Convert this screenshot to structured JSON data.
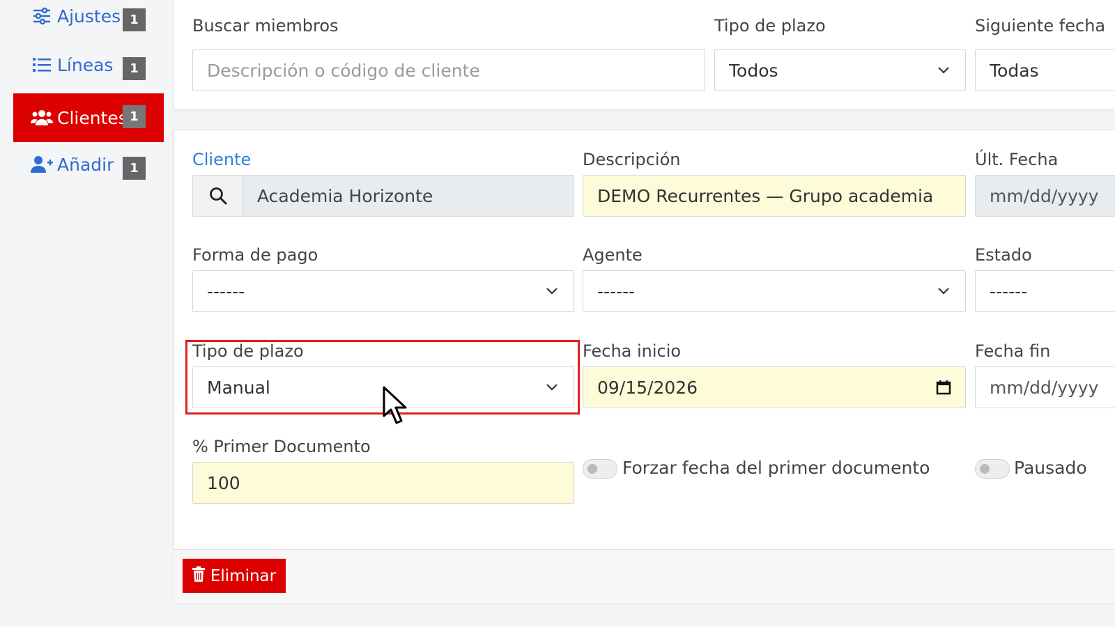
{
  "sidebar": {
    "items": [
      {
        "label": "Ajustes",
        "badge": "1",
        "icon": "sliders-icon"
      },
      {
        "label": "Líneas",
        "badge": "1",
        "icon": "list-icon"
      },
      {
        "label": "Clientes",
        "badge": "1",
        "icon": "users-icon",
        "active": true
      },
      {
        "label": "Añadir",
        "badge": "1",
        "icon": "user-plus-icon"
      }
    ]
  },
  "filters": {
    "search_label": "Buscar miembros",
    "search_placeholder": "Descripción o código de cliente",
    "term_type_label": "Tipo de plazo",
    "term_type_value": "Todos",
    "next_date_label": "Siguiente fecha",
    "next_date_value": "Todas"
  },
  "form": {
    "client_label": "Cliente",
    "client_value": "Academia Horizonte",
    "description_label": "Descripción",
    "description_value": "DEMO Recurrentes — Grupo academia",
    "last_date_label": "Últ. Fecha",
    "last_date_value": "mm/dd/yyyy",
    "payment_label": "Forma de pago",
    "payment_value": "------",
    "agent_label": "Agente",
    "agent_value": "------",
    "status_label": "Estado",
    "status_value": "------",
    "term_label": "Tipo de plazo",
    "term_value": "Manual",
    "start_date_label": "Fecha inicio",
    "start_date_value": "09/15/2026",
    "end_date_label": "Fecha fin",
    "end_date_value": "mm/dd/yyyy",
    "first_doc_label": "% Primer Documento",
    "first_doc_value": "100",
    "force_date_label": "Forzar fecha del primer documento",
    "paused_label": "Pausado"
  },
  "footer": {
    "delete_label": "Eliminar"
  },
  "colors": {
    "accent_red": "#dd0000",
    "link_blue": "#2f6bd0",
    "highlight_yellow": "#fefbd9"
  }
}
